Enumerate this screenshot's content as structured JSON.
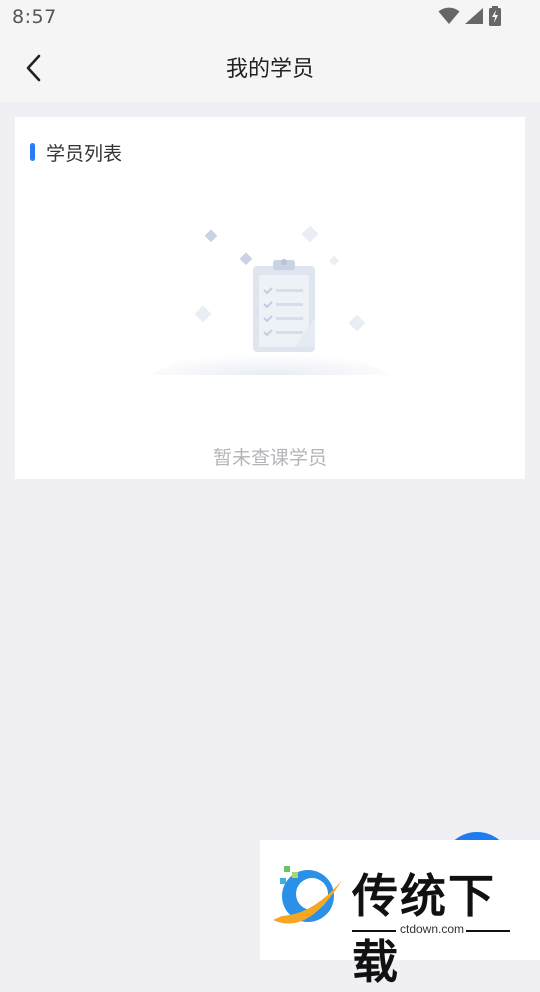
{
  "status_bar": {
    "time": "8:57",
    "icons": [
      "wifi-icon",
      "signal-icon",
      "battery-charging-icon"
    ]
  },
  "header": {
    "back_icon": "chevron-left-icon",
    "title": "我的学员"
  },
  "card": {
    "title": "学员列表",
    "accent_color": "#2a7bf5",
    "empty_illustration": "clipboard-empty-icon",
    "empty_text": "暂未查课学员"
  },
  "fab": {
    "color": "#1f7cf0"
  },
  "watermark": {
    "brand": "传统下载",
    "url": "ctdown.com"
  }
}
